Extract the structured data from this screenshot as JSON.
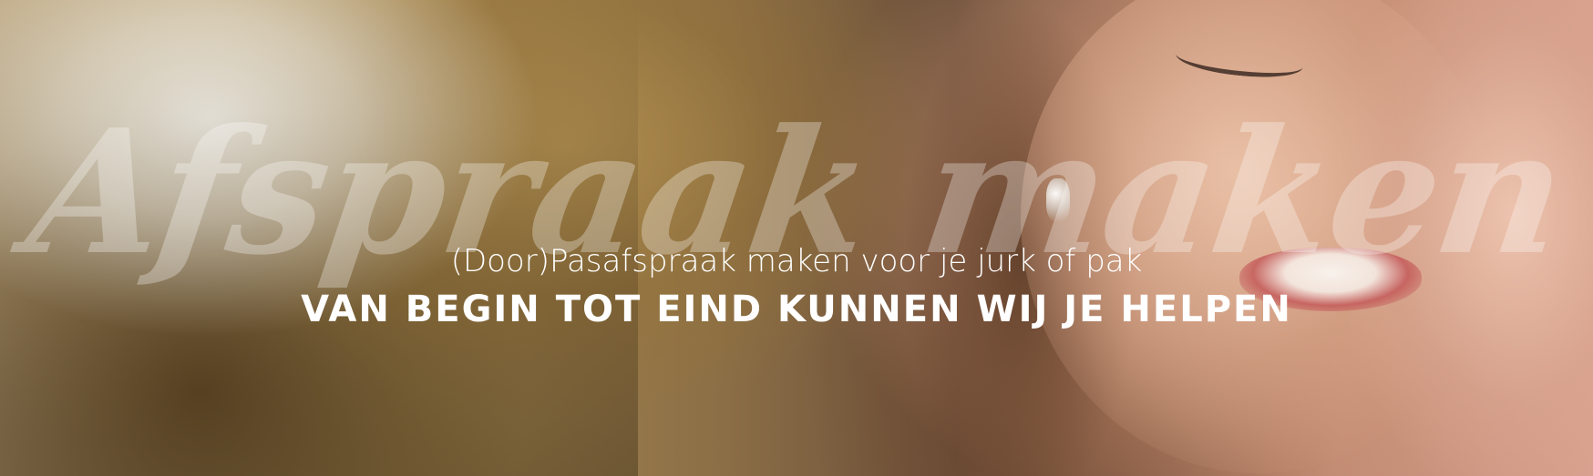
{
  "banner": {
    "script_title": "Afspraak maken",
    "subtitle": "(Door)Pasafspraak maken voor je jurk of pak",
    "headline": "VAN BEGIN TOT EIND KUNNEN WIJ JE HELPEN"
  },
  "colors": {
    "text": "#ffffff",
    "watermark": "rgba(255,255,255,0.30)"
  }
}
